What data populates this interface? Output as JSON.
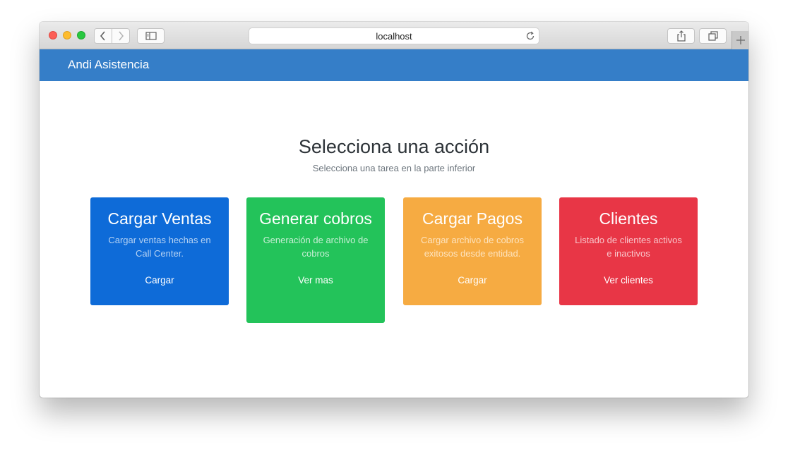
{
  "browser": {
    "url": "localhost"
  },
  "navbar": {
    "brand": "Andi Asistencia"
  },
  "main": {
    "title": "Selecciona una acción",
    "subtitle": "Selecciona una tarea en la parte inferior",
    "cards": [
      {
        "title": "Cargar Ventas",
        "description": "Cargar ventas hechas en Call Center.",
        "action": "Cargar",
        "color": "#0e6bd8"
      },
      {
        "title": "Generar cobros",
        "description": "Generación de archivo de cobros",
        "action": "Ver mas",
        "color": "#23c35a"
      },
      {
        "title": "Cargar Pagos",
        "description": "Cargar archivo de cobros exitosos desde entidad.",
        "action": "Cargar",
        "color": "#f6ab42"
      },
      {
        "title": "Clientes",
        "description": "Listado de clientes activos e inactivos",
        "action": "Ver clientes",
        "color": "#e83646"
      }
    ]
  },
  "colors": {
    "navbar": "#357ec8"
  },
  "icons": {
    "back": "chevron-left-icon",
    "forward": "chevron-right-icon",
    "sidebar": "sidebar-icon",
    "reload": "reload-icon",
    "share": "share-icon",
    "tabs": "tabs-icon",
    "new_tab": "plus-icon"
  }
}
